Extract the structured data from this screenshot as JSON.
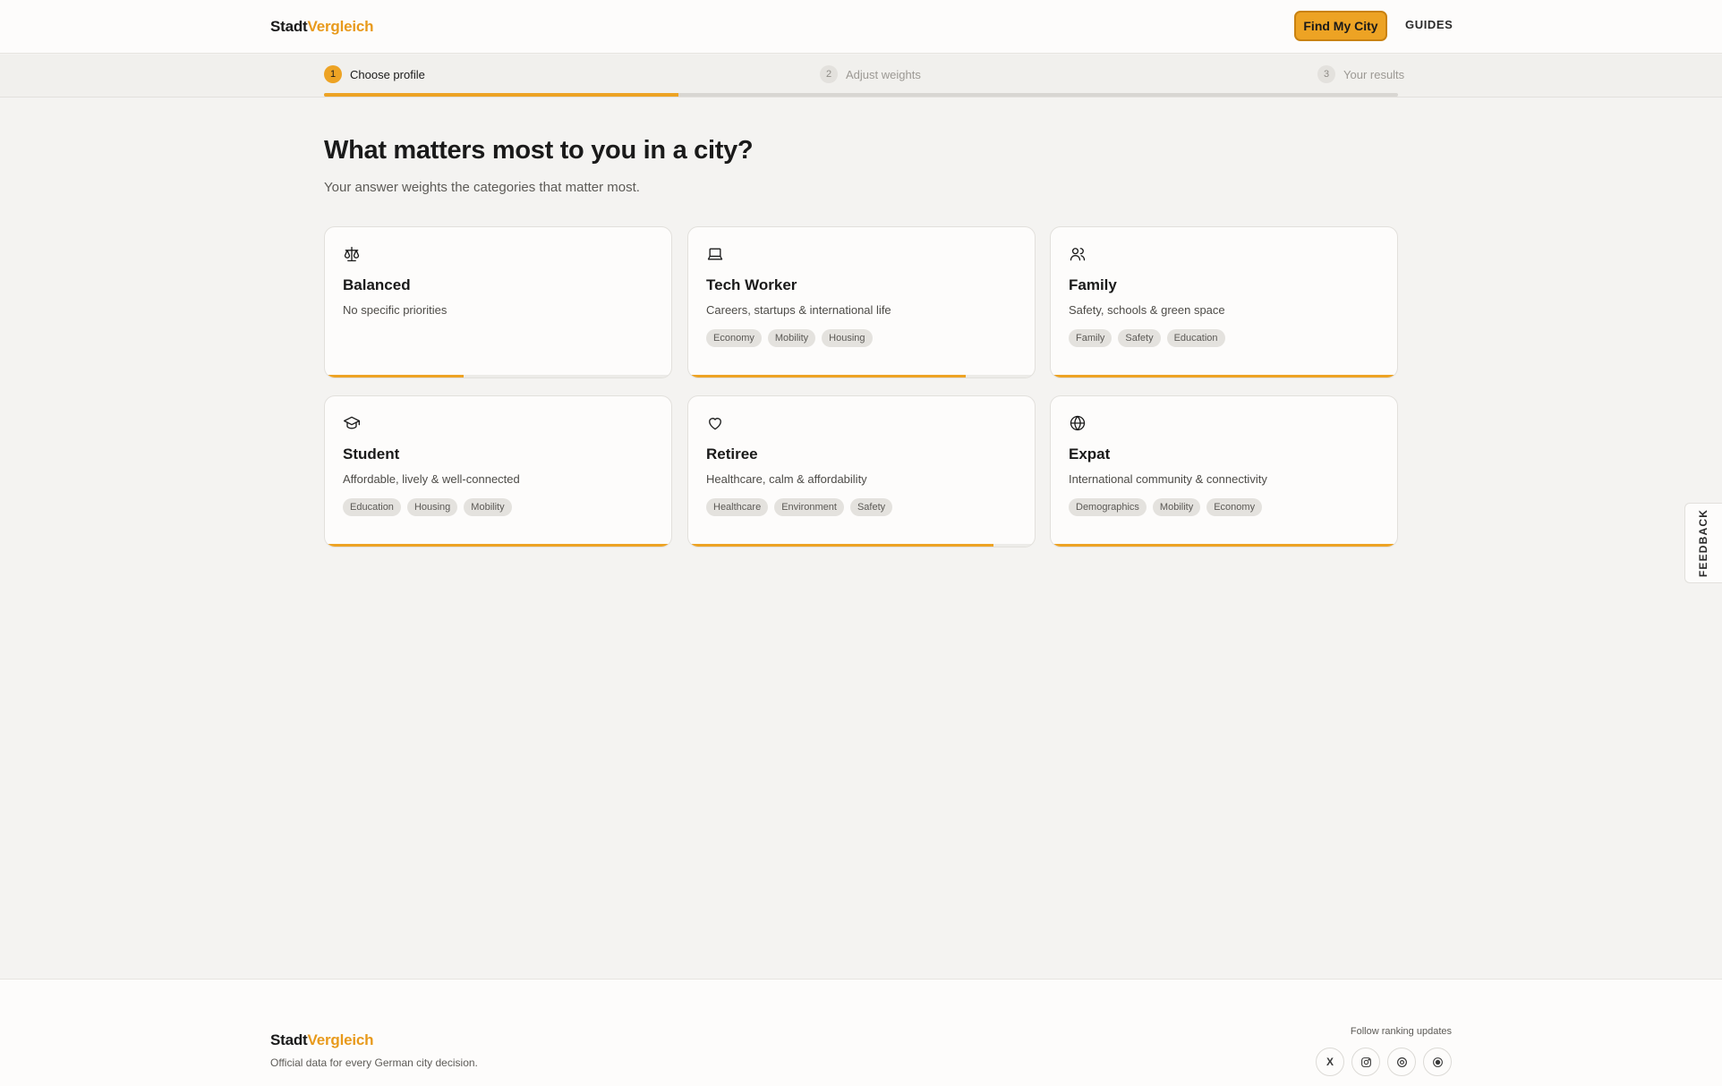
{
  "header": {
    "logo_part1": "Stadt",
    "logo_part2": "Vergleich",
    "cta_label": "Find My City",
    "guides_label": "GUIDES"
  },
  "stepper": {
    "steps": [
      {
        "num": "1",
        "label": "Choose profile",
        "state": "active"
      },
      {
        "num": "2",
        "label": "Adjust weights",
        "state": "inactive"
      },
      {
        "num": "3",
        "label": "Your results",
        "state": "inactive"
      }
    ],
    "progress_fraction": 0.33
  },
  "main": {
    "title": "What matters most to you in a city?",
    "subtitle": "Your answer weights the categories that matter most."
  },
  "profiles": [
    {
      "name": "Balanced",
      "icon": "scale-icon",
      "desc": "No specific priorities",
      "tags": [],
      "bar_fraction": 0.4
    },
    {
      "name": "Tech Worker",
      "icon": "laptop-icon",
      "desc": "Careers, startups & international life",
      "tags": [
        "Economy",
        "Mobility",
        "Housing"
      ],
      "bar_fraction": 0.8
    },
    {
      "name": "Family",
      "icon": "users-icon",
      "desc": "Safety, schools & green space",
      "tags": [
        "Family",
        "Safety",
        "Education"
      ],
      "bar_fraction": 1.0
    },
    {
      "name": "Student",
      "icon": "graduation-cap-icon",
      "desc": "Affordable, lively & well-connected",
      "tags": [
        "Education",
        "Housing",
        "Mobility"
      ],
      "bar_fraction": 1.0
    },
    {
      "name": "Retiree",
      "icon": "heart-icon",
      "desc": "Healthcare, calm & affordability",
      "tags": [
        "Healthcare",
        "Environment",
        "Safety"
      ],
      "bar_fraction": 0.88
    },
    {
      "name": "Expat",
      "icon": "globe-icon",
      "desc": "International community & connectivity",
      "tags": [
        "Demographics",
        "Mobility",
        "Economy"
      ],
      "bar_fraction": 1.0
    }
  ],
  "feedback": {
    "label": "FEEDBACK"
  },
  "footer": {
    "logo_part1": "Stadt",
    "logo_part2": "Vergleich",
    "tagline": "Official data for every German city decision.",
    "follow_label": "Follow ranking updates",
    "socials": [
      {
        "icon": "x-icon",
        "glyph": "X"
      },
      {
        "icon": "instagram-icon",
        "glyph": ""
      },
      {
        "icon": "threads-icon",
        "glyph": ""
      },
      {
        "icon": "circle-dot-icon",
        "glyph": ""
      }
    ]
  },
  "colors": {
    "accent": "#eda324",
    "accent_border": "#c98211",
    "background": "#f4f3f1"
  }
}
